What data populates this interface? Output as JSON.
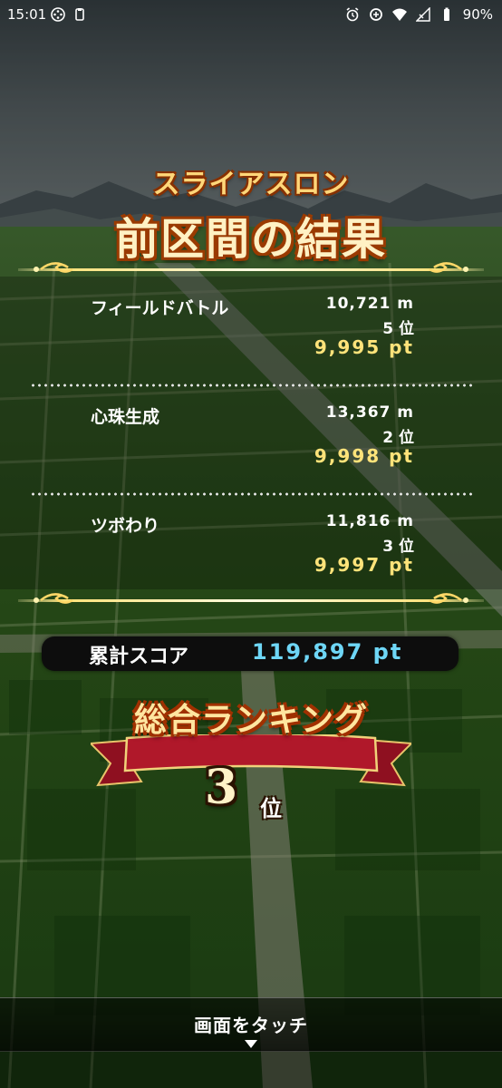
{
  "status_bar": {
    "time": "15:01",
    "battery": "90%",
    "icons": [
      "game-controller-icon",
      "clipboard-icon",
      "alarm-icon",
      "data-saver-icon",
      "wifi-icon",
      "signal-icon",
      "battery-icon"
    ]
  },
  "header": {
    "subtitle": "スライアスロン",
    "title": "前区間の結果"
  },
  "events": [
    {
      "name": "フィールドバトル",
      "distance": "10,721 m",
      "rank": "5 位",
      "points": "9,995 pt"
    },
    {
      "name": "心珠生成",
      "distance": "13,367 m",
      "rank": "2 位",
      "points": "9,998 pt"
    },
    {
      "name": "ツボわり",
      "distance": "11,816 m",
      "rank": "3 位",
      "points": "9,997 pt"
    }
  ],
  "total": {
    "label": "累計スコア",
    "value": "119,897 pt"
  },
  "ranking": {
    "title": "総合ランキング",
    "number": "3",
    "unit": "位"
  },
  "footer": {
    "touch_label": "画面をタッチ"
  },
  "colors": {
    "points": "#ffe37a",
    "total_value": "#6ed6f6",
    "title_outline": "#9a3a00",
    "ribbon": "#b0182a"
  }
}
